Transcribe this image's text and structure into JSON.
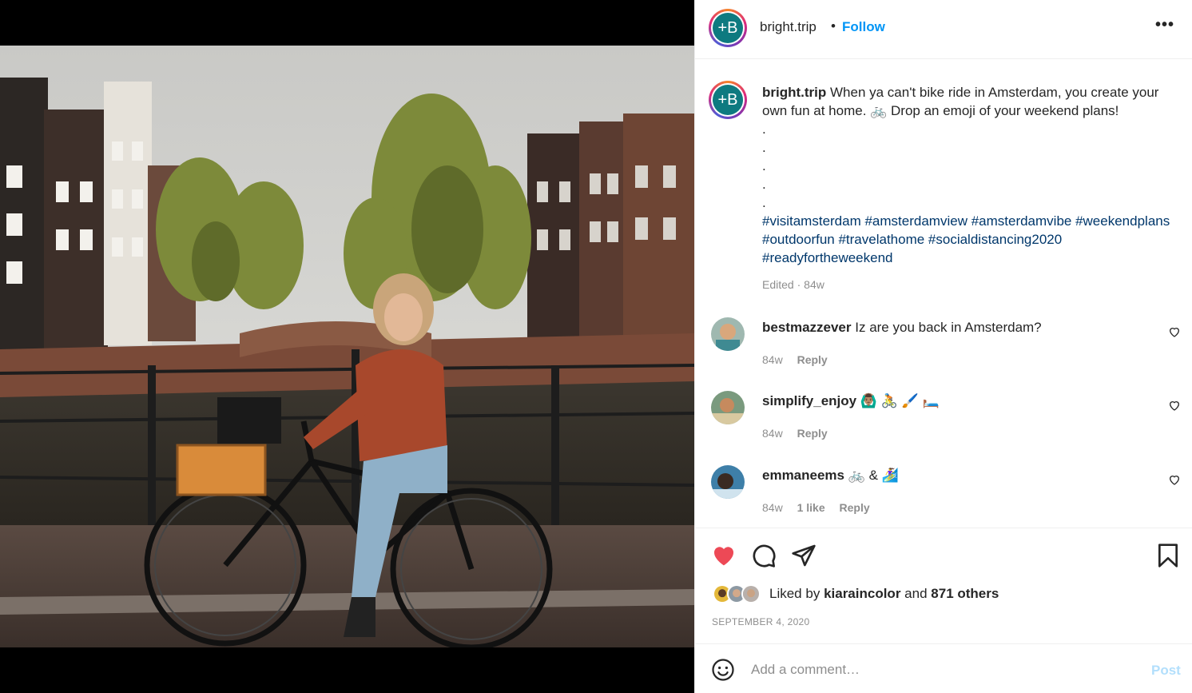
{
  "post": {
    "username": "bright.trip",
    "avatar_initials": "+B",
    "follow_label": "Follow",
    "separator": "•",
    "more_icon": "more-horizontal-icon"
  },
  "caption": {
    "username": "bright.trip",
    "text_line": "When ya can't bike ride in Amsterdam, you create your own fun at home. 🚲 Drop an emoji of your weekend plans!",
    "dots": [
      ".",
      ".",
      ".",
      ".",
      "."
    ],
    "hashtags": "#visitamsterdam #amsterdamview #amsterdamvibe #weekendplans #outdoorfun #travelathome #socialdistancing2020 #readyfortheweekend",
    "edited": "Edited",
    "age": "84w"
  },
  "comments": [
    {
      "username": "bestmazzever",
      "text": "Iz are you back in Amsterdam?",
      "age": "84w",
      "likes": "",
      "reply": "Reply"
    },
    {
      "username": "simplify_enjoy",
      "text": "🙆🏽‍♂️ 🚴 🖌️ 🛏️",
      "age": "84w",
      "likes": "",
      "reply": "Reply"
    },
    {
      "username": "emmaneems",
      "text": "🚲 & 🏄‍♀️",
      "age": "84w",
      "likes": "1 like",
      "reply": "Reply"
    }
  ],
  "actions": {
    "liked_prefix": "Liked by",
    "liked_user": "kiaraincolor",
    "liked_and": "and",
    "liked_others": "871 others",
    "date": "SEPTEMBER 4, 2020",
    "like_color": "#ed4956"
  },
  "add_comment": {
    "placeholder": "Add a comment…",
    "post_label": "Post"
  },
  "colors": {
    "link": "#0095f6",
    "hashtag": "#00376b",
    "muted": "#8e8e8e"
  }
}
